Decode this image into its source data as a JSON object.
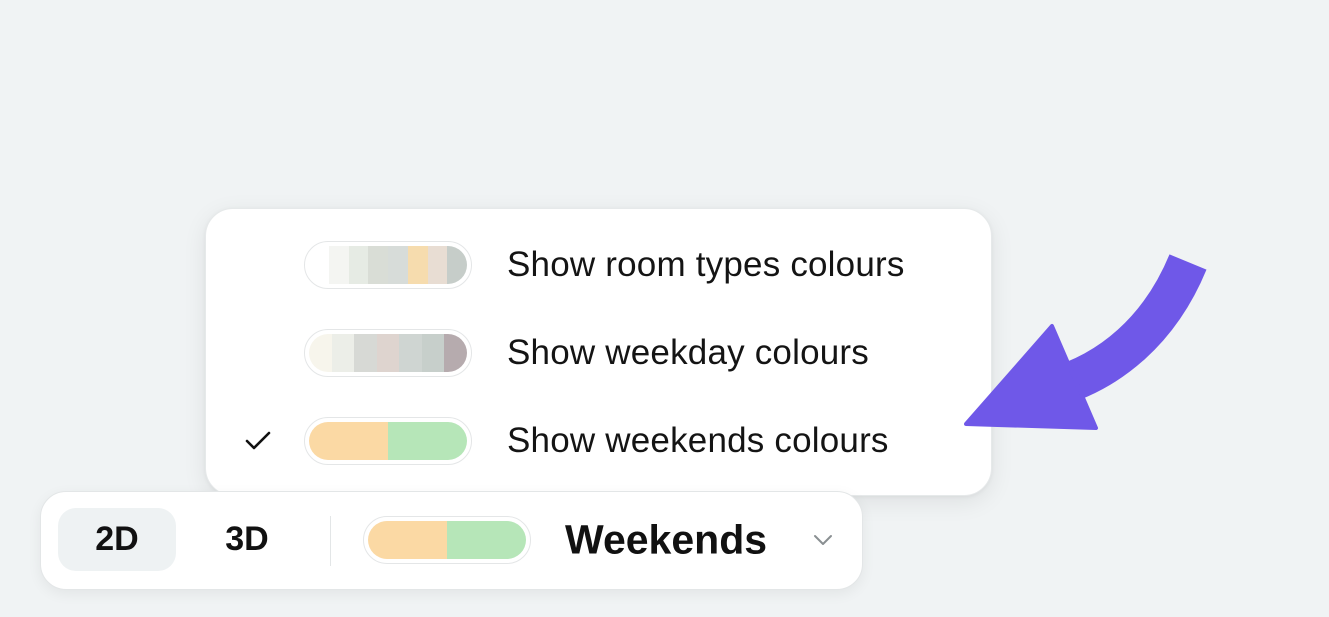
{
  "menu": {
    "items": [
      {
        "label": "Show room types colours",
        "checked": false,
        "swatch": [
          "#ffffff",
          "#f4f5f2",
          "#e6ebe4",
          "#d9ddd6",
          "#d7dcd9",
          "#f6dcae",
          "#e8ddd3",
          "#c6cdc9"
        ]
      },
      {
        "label": "Show weekday colours",
        "checked": false,
        "swatch": [
          "#f7f5ec",
          "#eceee8",
          "#d7d9d5",
          "#ded4cf",
          "#cfd5d2",
          "#c7cfcb",
          "#b6abae"
        ]
      },
      {
        "label": "Show weekends colours",
        "checked": true,
        "swatch": [
          "#fbd9a4",
          "#b6e6b8"
        ]
      }
    ]
  },
  "toolbar": {
    "btn_2d": "2D",
    "btn_3d": "3D",
    "selected_label": "Weekends",
    "selected_swatch": [
      "#fbd9a4",
      "#b6e6b8"
    ]
  },
  "icons": {
    "check": "check-icon",
    "chevron": "chevron-down-icon",
    "annotation_arrow": "curved-arrow-icon"
  },
  "colors": {
    "arrow": "#6f58e8",
    "background": "#f0f3f4",
    "active_button_bg": "#eef2f3"
  }
}
